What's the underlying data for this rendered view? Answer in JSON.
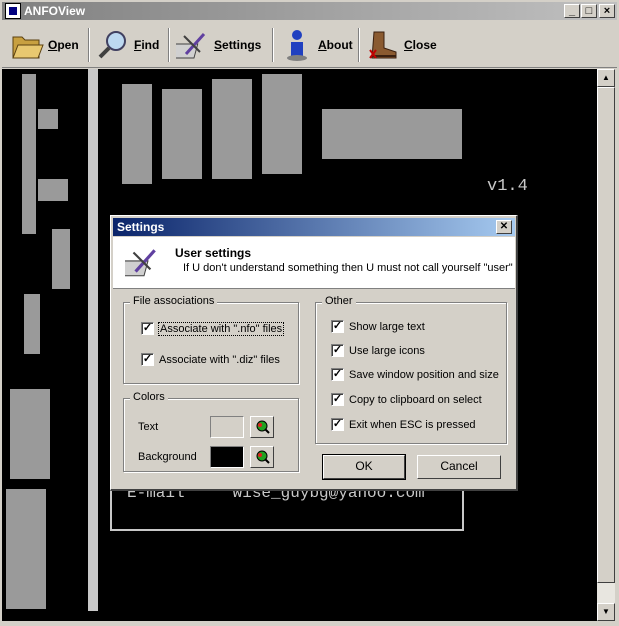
{
  "window": {
    "title": "ANFOView"
  },
  "toolbar": {
    "items": [
      {
        "label": "Open",
        "icon": "folder-open-icon"
      },
      {
        "label": "Find",
        "icon": "magnifier-icon"
      },
      {
        "label": "Settings",
        "icon": "settings-icon"
      },
      {
        "label": "About",
        "icon": "info-person-icon"
      },
      {
        "label": "Close",
        "icon": "boot-icon"
      }
    ]
  },
  "viewer": {
    "version": "v1.4",
    "email_label": "E-mail",
    "email_value": "wise_guybg@yahoo.com"
  },
  "dialog": {
    "title": "Settings",
    "header_title": "User settings",
    "header_subtitle": "If U don't understand something then U must not call yourself \"user\"",
    "file_assoc": {
      "legend": "File associations",
      "items": [
        {
          "label": "Associate with \".nfo\" files",
          "checked": true
        },
        {
          "label": "Associate with \".diz\" files",
          "checked": true
        }
      ]
    },
    "colors": {
      "legend": "Colors",
      "text_label": "Text",
      "background_label": "Background",
      "text_color": "#d4d0c8",
      "background_color": "#000000"
    },
    "other": {
      "legend": "Other",
      "items": [
        {
          "label": "Show large text",
          "checked": true
        },
        {
          "label": "Use large icons",
          "checked": true
        },
        {
          "label": "Save window position and size",
          "checked": true
        },
        {
          "label": "Copy to clipboard on select",
          "checked": true
        },
        {
          "label": "Exit when ESC is pressed",
          "checked": true
        }
      ]
    },
    "ok_label": "OK",
    "cancel_label": "Cancel"
  }
}
